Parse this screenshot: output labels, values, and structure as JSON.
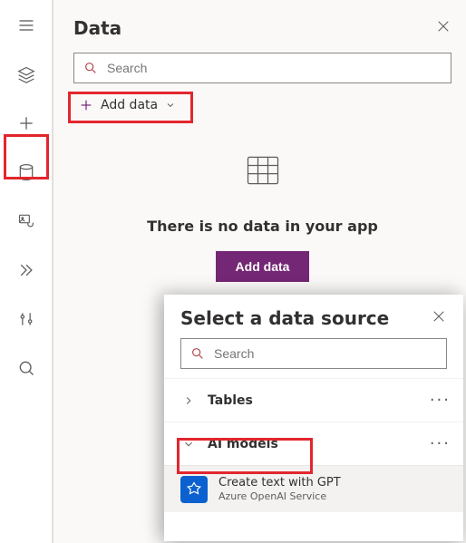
{
  "rail": {
    "items": [
      "hamburger",
      "layers",
      "plus",
      "database",
      "media",
      "expand",
      "sliders",
      "search"
    ]
  },
  "panel": {
    "title": "Data",
    "search_placeholder": "Search",
    "add_data_label": "Add data",
    "empty_text": "There is no data in your app",
    "add_data_button": "Add data"
  },
  "popup": {
    "title": "Select a data source",
    "search_placeholder": "Search",
    "sections": [
      {
        "label": "Tables",
        "expanded": false
      },
      {
        "label": "AI models",
        "expanded": true
      }
    ],
    "model": {
      "name": "Create text with GPT",
      "subtitle": "Azure OpenAI Service"
    }
  },
  "highlights": [
    "add-data-dropdown",
    "database-rail",
    "ai-models-section"
  ]
}
